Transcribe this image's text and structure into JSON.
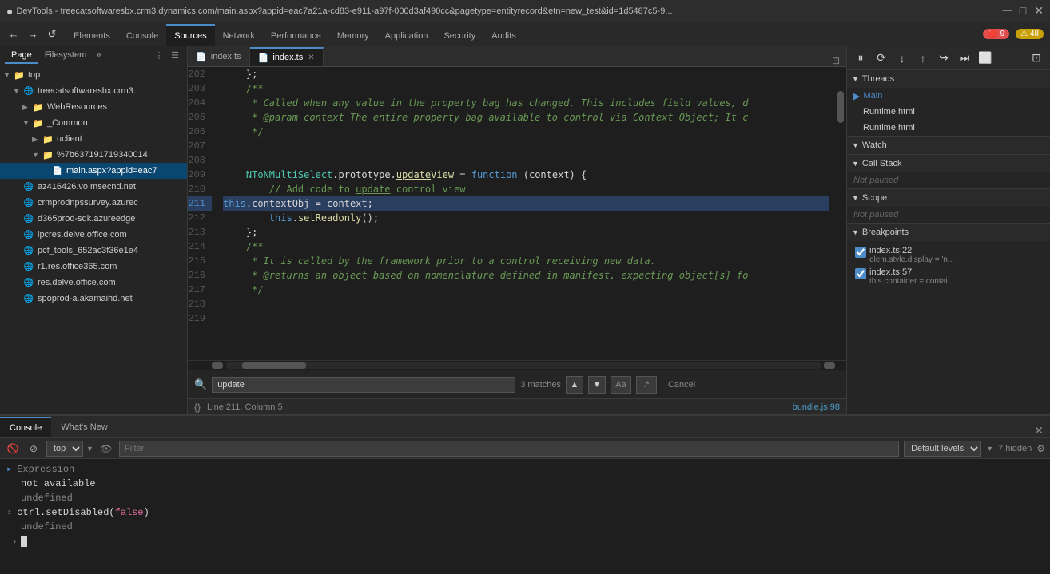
{
  "titlebar": {
    "title": "DevTools - treecatsoftwaresbx.crm3.dynamics.com/main.aspx?appid=eac7a21a-cd83-e911-a97f-000d3af490cc&pagetype=entityrecord&etn=new_test&id=1d5487c5-9...",
    "chrome_icon": "●"
  },
  "topnav": {
    "back_btn": "←",
    "forward_btn": "→",
    "refresh_btn": "↺",
    "tabs": [
      {
        "label": "Elements",
        "active": false
      },
      {
        "label": "Console",
        "active": false
      },
      {
        "label": "Sources",
        "active": true
      },
      {
        "label": "Network",
        "active": false
      },
      {
        "label": "Performance",
        "active": false
      },
      {
        "label": "Memory",
        "active": false
      },
      {
        "label": "Application",
        "active": false
      },
      {
        "label": "Security",
        "active": false
      },
      {
        "label": "Audits",
        "active": false
      }
    ],
    "errors_count": "9",
    "warnings_count": "48"
  },
  "sidebar": {
    "tabs": [
      {
        "label": "Page",
        "active": true
      },
      {
        "label": "Filesystem",
        "active": false
      }
    ],
    "overflow_icon": "»",
    "tree": [
      {
        "indent": 0,
        "arrow": "▼",
        "icon": "📁",
        "label": "top",
        "type": "folder",
        "level": 0
      },
      {
        "indent": 1,
        "arrow": "▼",
        "icon": "🌐",
        "label": "treecatsoftwaresbx.crm3.",
        "type": "cloud",
        "level": 1
      },
      {
        "indent": 2,
        "arrow": "▶",
        "icon": "📁",
        "label": "WebResources",
        "type": "folder",
        "level": 2
      },
      {
        "indent": 2,
        "arrow": "▼",
        "icon": "📁",
        "label": "_Common",
        "type": "folder",
        "level": 2
      },
      {
        "indent": 3,
        "arrow": "▶",
        "icon": "📁",
        "label": "uclient",
        "type": "folder",
        "level": 3
      },
      {
        "indent": 3,
        "arrow": "▼",
        "icon": "📁",
        "label": "%7b637191719340014",
        "type": "folder",
        "level": 3
      },
      {
        "indent": 4,
        "arrow": "",
        "icon": "📄",
        "label": "main.aspx?appid=eac7",
        "type": "file",
        "selected": true,
        "level": 4
      },
      {
        "indent": 1,
        "arrow": "",
        "icon": "🌐",
        "label": "az416426.vo.msecnd.net",
        "type": "cloud",
        "level": 1
      },
      {
        "indent": 1,
        "arrow": "",
        "icon": "🌐",
        "label": "crmprodnpssurvey.azurec",
        "type": "cloud",
        "level": 1
      },
      {
        "indent": 1,
        "arrow": "",
        "icon": "🌐",
        "label": "d365prod-sdk.azureedge",
        "type": "cloud",
        "level": 1
      },
      {
        "indent": 1,
        "arrow": "",
        "icon": "🌐",
        "label": "lpcres.delve.office.com",
        "type": "cloud",
        "level": 1
      },
      {
        "indent": 1,
        "arrow": "",
        "icon": "🌐",
        "label": "pcf_tools_652ac3f36e1e4",
        "type": "cloud",
        "level": 1
      },
      {
        "indent": 1,
        "arrow": "",
        "icon": "🌐",
        "label": "r1.res.office365.com",
        "type": "cloud",
        "level": 1
      },
      {
        "indent": 1,
        "arrow": "",
        "icon": "🌐",
        "label": "res.delve.office.com",
        "type": "cloud",
        "level": 1
      },
      {
        "indent": 1,
        "arrow": "",
        "icon": "🌐",
        "label": "spoprod-a.akamaihd.net",
        "type": "cloud",
        "level": 1
      }
    ]
  },
  "editor": {
    "tabs": [
      {
        "label": "index.ts",
        "active": false
      },
      {
        "label": "index.ts",
        "active": true
      }
    ],
    "lines": [
      {
        "num": 202,
        "text": "    };",
        "active": false,
        "highlighted": false
      },
      {
        "num": 203,
        "text": "    /**",
        "active": false,
        "highlighted": false
      },
      {
        "num": 204,
        "text": "     * Called when any value in the property bag has changed. This includes field values, d",
        "active": false,
        "highlighted": false,
        "comment": true
      },
      {
        "num": 205,
        "text": "     * @param context The entire property bag available to control via Context Object; It c",
        "active": false,
        "highlighted": false,
        "comment": true
      },
      {
        "num": 206,
        "text": "     */",
        "active": false,
        "highlighted": false,
        "comment": true
      },
      {
        "num": 207,
        "text": "",
        "active": false,
        "highlighted": false
      },
      {
        "num": 208,
        "text": "",
        "active": false,
        "highlighted": false
      },
      {
        "num": 209,
        "text": "    NToNMultiSelect.prototype.updateView = function (context) {",
        "active": false,
        "highlighted": false
      },
      {
        "num": 210,
        "text": "        // Add code to update control view",
        "active": false,
        "highlighted": false,
        "comment": true
      },
      {
        "num": 211,
        "text": "        this.contextObj = context;",
        "active": true,
        "highlighted": true
      },
      {
        "num": 212,
        "text": "        this.setReadonly();",
        "active": false,
        "highlighted": false
      },
      {
        "num": 213,
        "text": "    };",
        "active": false,
        "highlighted": false
      },
      {
        "num": 214,
        "text": "    /**",
        "active": false,
        "highlighted": false,
        "comment": true
      },
      {
        "num": 215,
        "text": "     * It is called by the framework prior to a control receiving new data.",
        "active": false,
        "highlighted": false,
        "comment": true
      },
      {
        "num": 216,
        "text": "     * @returns an object based on nomenclature defined in manifest, expecting object[s] fo",
        "active": false,
        "highlighted": false,
        "comment": true
      },
      {
        "num": 217,
        "text": "     */",
        "active": false,
        "highlighted": false,
        "comment": true
      },
      {
        "num": 218,
        "text": "",
        "active": false,
        "highlighted": false
      },
      {
        "num": 219,
        "text": "",
        "active": false,
        "highlighted": false
      }
    ]
  },
  "search_bar": {
    "placeholder": "update",
    "value": "update",
    "match_count": "3 matches",
    "up_btn": "▲",
    "down_btn": "▼",
    "match_case_label": "Aa",
    "regex_label": ".*",
    "cancel_label": "Cancel"
  },
  "status_bar": {
    "curly_icon": "{}",
    "position": "Line 211, Column 5",
    "link": "bundle.js:98"
  },
  "right_panel": {
    "debug_btns": [
      "⏸",
      "⟳",
      "↓",
      "↑",
      "↪",
      "⏭",
      "⬜",
      "⊡"
    ],
    "sections": [
      {
        "label": "Threads",
        "open": true,
        "items": [
          {
            "label": "Main",
            "active": true
          },
          {
            "label": "Runtime.html"
          },
          {
            "label": "Runtime.html"
          }
        ]
      },
      {
        "label": "Watch",
        "open": true
      },
      {
        "label": "Call Stack",
        "open": true,
        "not_paused": "Not paused"
      },
      {
        "label": "Scope",
        "open": true,
        "not_paused": "Not paused"
      },
      {
        "label": "Breakpoints",
        "open": true,
        "items": [
          {
            "file": "index.ts:22",
            "code": "elem.style.display = 'n...",
            "checked": true
          },
          {
            "file": "index.ts:57",
            "code": "this.container = contai...",
            "checked": true
          }
        ]
      }
    ]
  },
  "bottom_panel": {
    "tabs": [
      {
        "label": "Console",
        "active": true
      },
      {
        "label": "What's New",
        "active": false
      }
    ],
    "toolbar": {
      "clear_btn": "🚫",
      "stop_btn": "⊘",
      "context_options": [
        "top"
      ],
      "context_selected": "top",
      "eye_icon": "👁",
      "filter_placeholder": "Filter",
      "level_options": [
        "Default levels"
      ],
      "level_selected": "Default levels",
      "hidden_count": "7 hidden",
      "settings_icon": "⚙"
    },
    "console_lines": [
      {
        "type": "expression",
        "text": "Expression",
        "style": "grey",
        "arrow": "▸"
      },
      {
        "type": "output",
        "text": "not available",
        "style": "normal"
      },
      {
        "type": "output",
        "text": "undefined",
        "style": "grey"
      },
      {
        "type": "input",
        "text": "ctrl.setDisabled(false)",
        "style": "pink",
        "prompt": ">"
      },
      {
        "type": "output",
        "text": "undefined",
        "style": "grey"
      },
      {
        "type": "prompt_empty",
        "text": "",
        "prompt": ">"
      }
    ]
  }
}
